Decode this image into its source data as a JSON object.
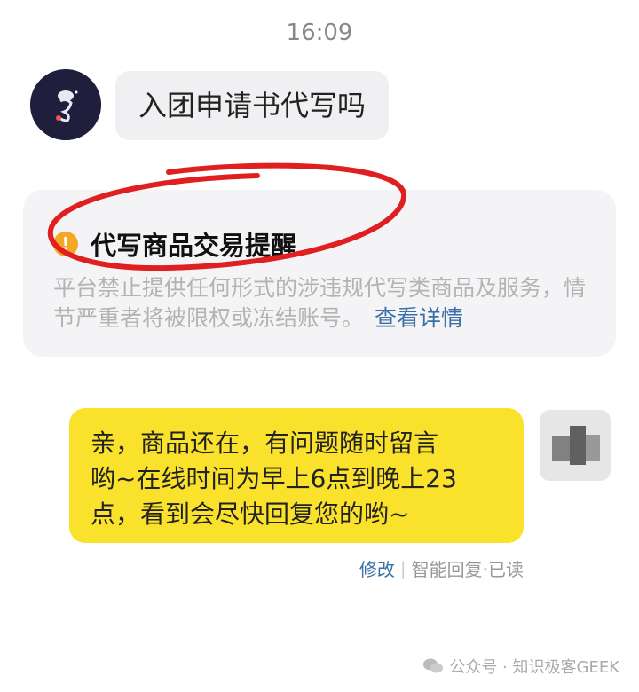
{
  "status": {
    "time": "16:09"
  },
  "incoming_message": {
    "text": "入团申请书代写吗"
  },
  "notice": {
    "title": "代写商品交易提醒",
    "body": "平台禁止提供任何形式的涉违规代写类商品及服务，情节严重者将被限权或冻结账号。",
    "link": "查看详情"
  },
  "outgoing_message": {
    "line1": "亲，商品还在，有问题随时留言",
    "line2": "哟~在线时间为早上6点到晚上23",
    "line3": "点，看到会尽快回复您的哟~"
  },
  "message_meta": {
    "edit": "修改",
    "separator": "|",
    "status": "智能回复·已读"
  },
  "watermark": {
    "text": "公众号 · 知识极客GEEK"
  },
  "colors": {
    "bubble_out": "#fae12c",
    "bubble_in": "#f0f0f2",
    "link": "#3a6fa8",
    "warning": "#f5a623",
    "annotation": "#e02020"
  }
}
